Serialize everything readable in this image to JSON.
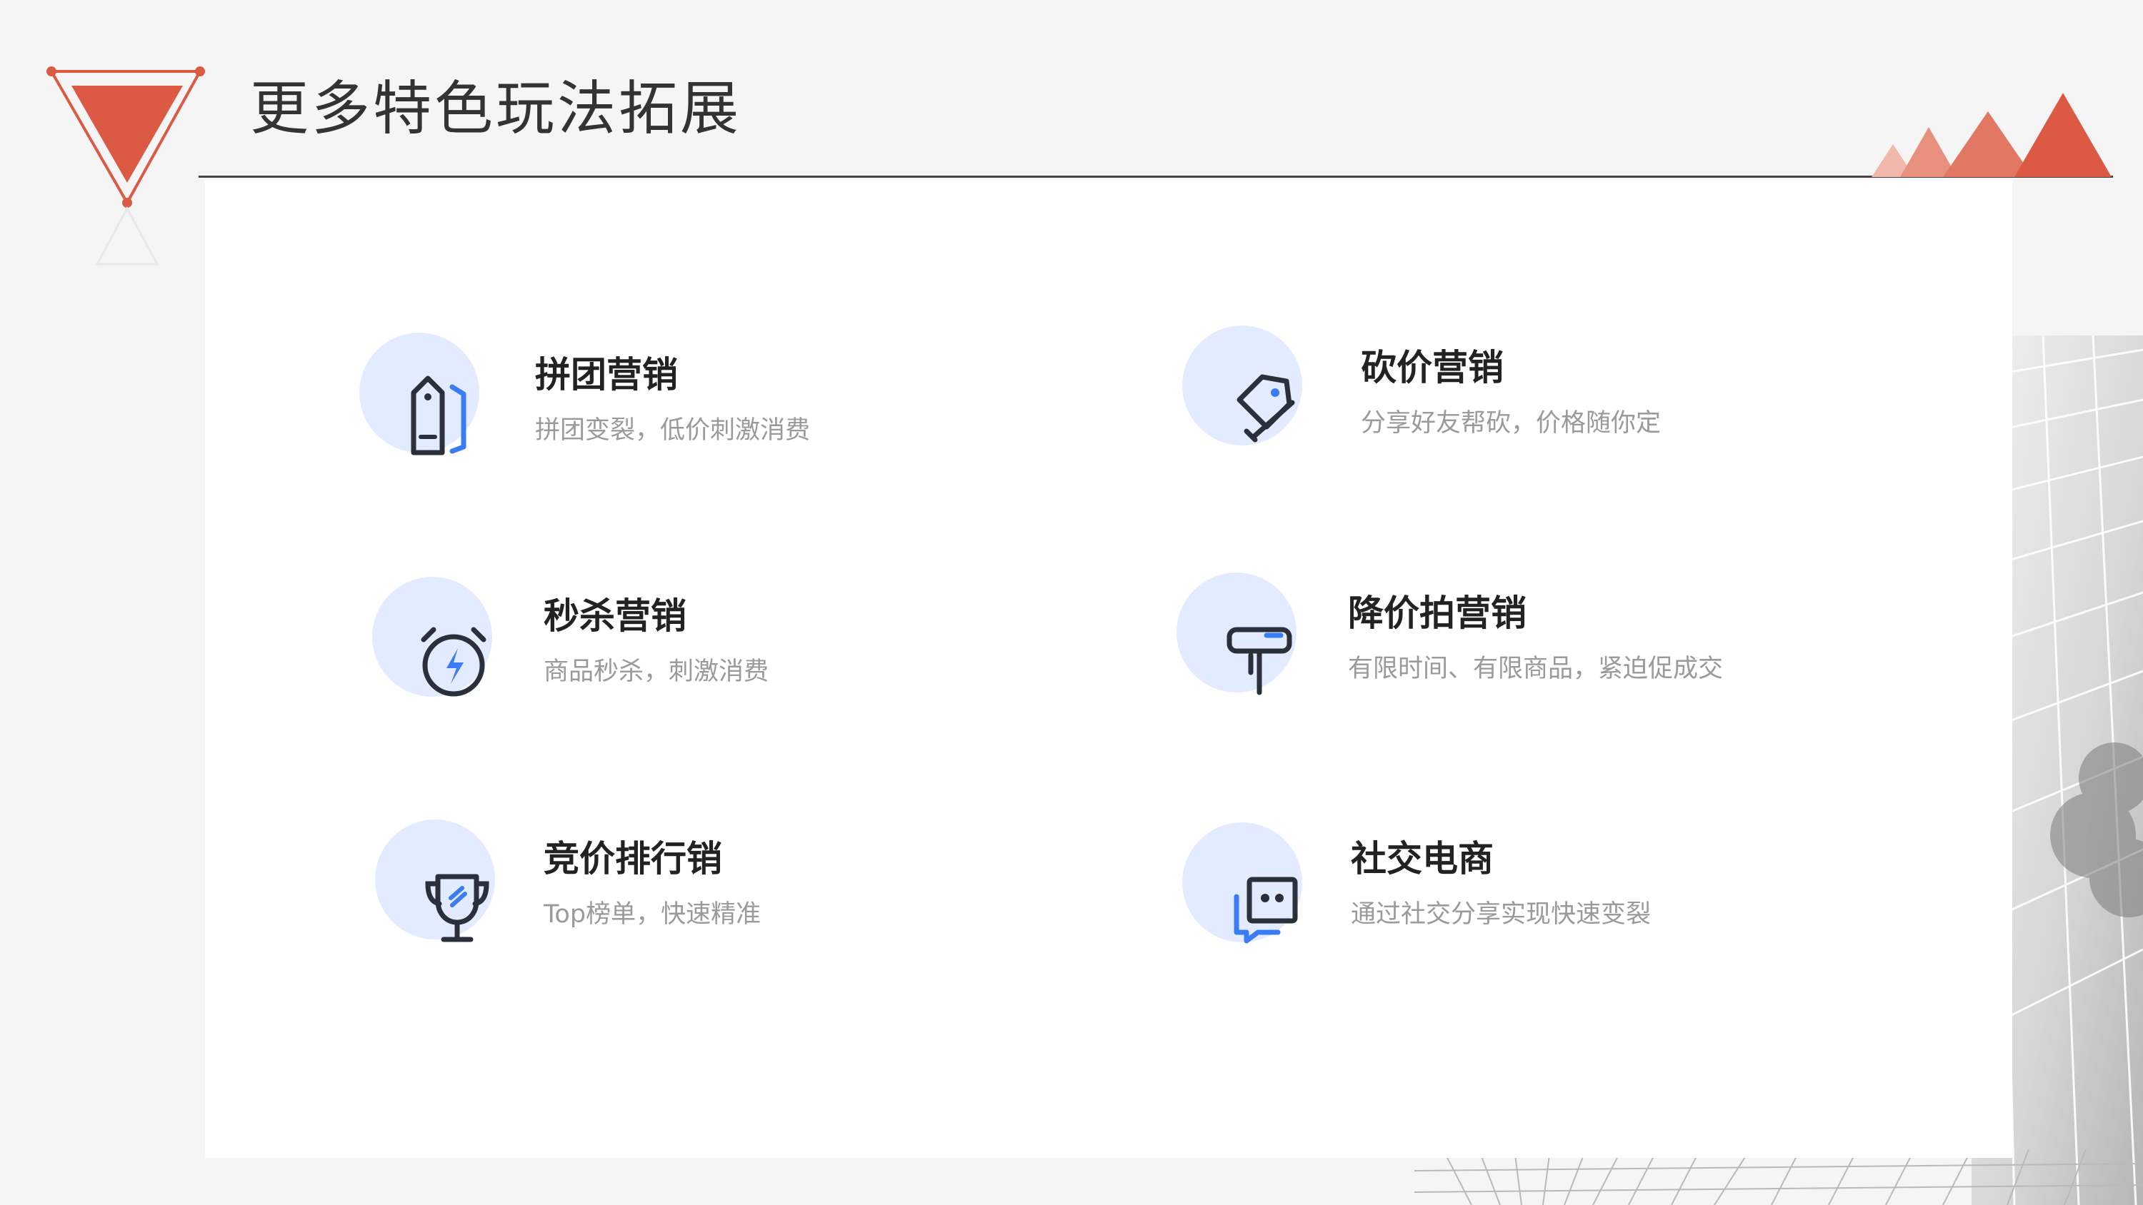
{
  "title": "更多特色玩法拓展",
  "features": [
    {
      "title": "拼团营销",
      "desc": "拼团变裂，低价刺激消费",
      "icon": "price-tag-icon"
    },
    {
      "title": "砍价营销",
      "desc": "分享好友帮砍，价格随你定",
      "icon": "cut-price-tag-icon"
    },
    {
      "title": "秒杀营销",
      "desc": "商品秒杀，刺激消费",
      "icon": "alarm-clock-icon"
    },
    {
      "title": "降价拍营销",
      "desc": "有限时间、有限商品，紧迫促成交",
      "icon": "hammer-icon"
    },
    {
      "title": "竞价排行销",
      "desc": "Top榜单，快速精准",
      "icon": "trophy-icon"
    },
    {
      "title": "社交电商",
      "desc": "通过社交分享实现快速变裂",
      "icon": "chat-icon"
    }
  ],
  "colors": {
    "accent": "#dc5a44",
    "icon_blue": "#3b7cf4",
    "icon_dark": "#2a2f3a",
    "blob": "#e2ebff"
  }
}
